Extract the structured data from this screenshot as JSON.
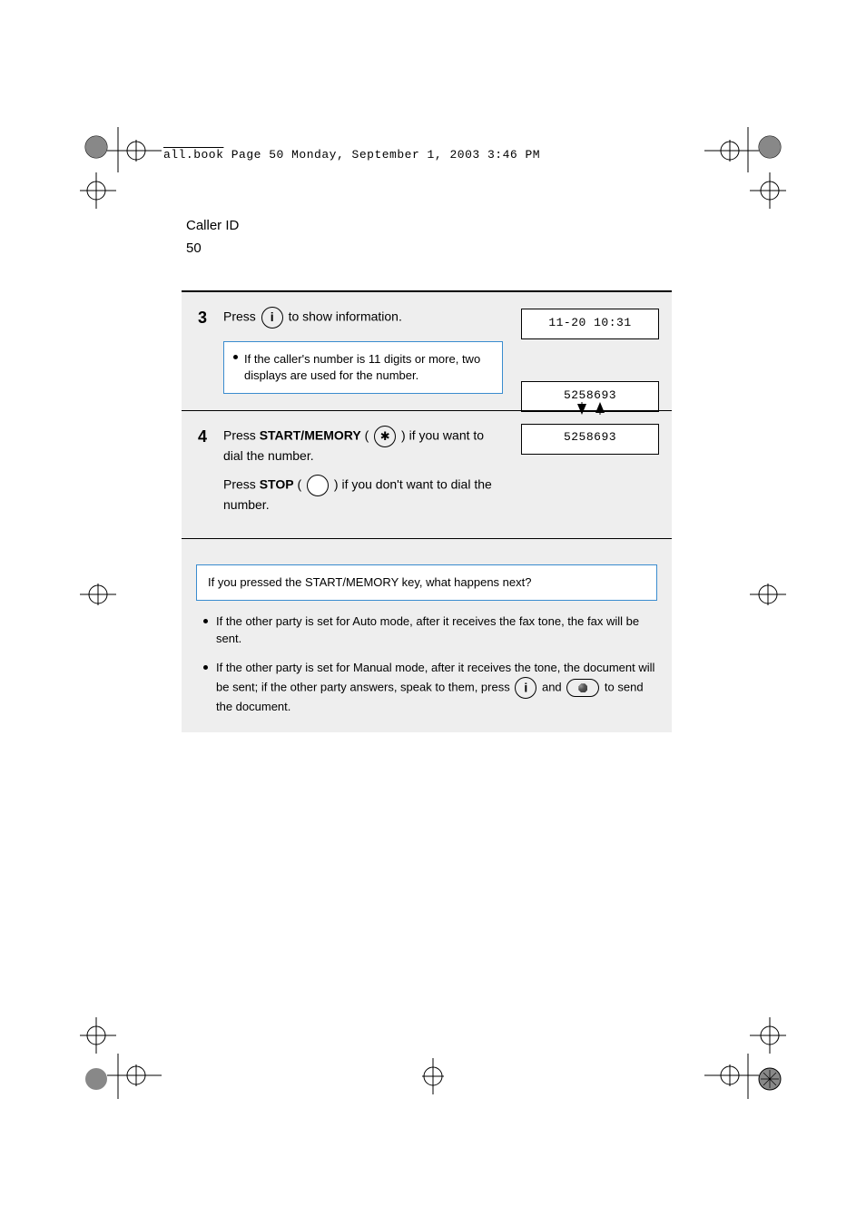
{
  "slug": {
    "filename": "all.book",
    "rest": "  Page 50  Monday, September 1, 2003  3:46 PM"
  },
  "header": {
    "title": "Caller ID",
    "pagenum": "50"
  },
  "step3": {
    "num": "3",
    "text_before": "Press ",
    "text_after": " to show information.",
    "display_a": "11-20 10:31",
    "display_b": "5258693",
    "note_text": "If the caller's number is 11 digits or more, two displays are used for the number."
  },
  "step4": {
    "num": "4",
    "text_before_1": "Press ",
    "key_label_1": "START/MEMORY",
    "text_after_1": " (",
    "text_after_1b": ") if you want to dial the number.",
    "text_before_2": "Press ",
    "key_label_2": "STOP",
    "text_after_2": " (",
    "text_after_2b": ") if you don't want to dial the number.",
    "display_alt": "5258693"
  },
  "footnote": {
    "box_text": "If you pressed the START/MEMORY key, what happens next?",
    "bullet1": "If the other party is set for Auto mode, after it receives the fax tone, the fax will be sent.",
    "bullet2_before": "If the other party is set for Manual mode, after it receives the tone, the document will be sent; if the other party answers, speak to them, press ",
    "bullet2_mid": " and ",
    "bullet2_after": " to send the document."
  }
}
